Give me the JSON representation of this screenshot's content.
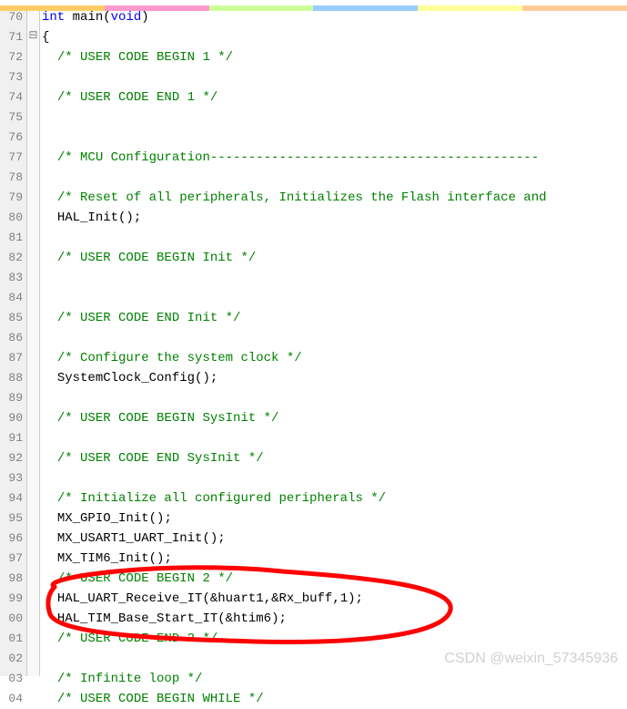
{
  "lines": [
    {
      "num": "70",
      "fold": "",
      "indent": 0,
      "tokens": [
        {
          "t": "kw",
          "v": "int"
        },
        {
          "t": "plain",
          "v": " main"
        },
        {
          "t": "paren",
          "v": "("
        },
        {
          "t": "kw",
          "v": "void"
        },
        {
          "t": "paren",
          "v": ")"
        }
      ]
    },
    {
      "num": "71",
      "fold": "⊟",
      "indent": 0,
      "tokens": [
        {
          "t": "paren",
          "v": "{"
        }
      ]
    },
    {
      "num": "72",
      "fold": "",
      "indent": 1,
      "tokens": [
        {
          "t": "comment",
          "v": "/* USER CODE BEGIN 1 */"
        }
      ]
    },
    {
      "num": "73",
      "fold": "",
      "indent": 0,
      "tokens": []
    },
    {
      "num": "74",
      "fold": "",
      "indent": 1,
      "tokens": [
        {
          "t": "comment",
          "v": "/* USER CODE END 1 */"
        }
      ]
    },
    {
      "num": "75",
      "fold": "",
      "indent": 0,
      "tokens": []
    },
    {
      "num": "76",
      "fold": "",
      "indent": 0,
      "tokens": []
    },
    {
      "num": "77",
      "fold": "",
      "indent": 1,
      "tokens": [
        {
          "t": "comment",
          "v": "/* MCU Configuration-------------------------------------------"
        }
      ]
    },
    {
      "num": "78",
      "fold": "",
      "indent": 0,
      "tokens": []
    },
    {
      "num": "79",
      "fold": "",
      "indent": 1,
      "tokens": [
        {
          "t": "comment",
          "v": "/* Reset of all peripherals, Initializes the Flash interface and"
        }
      ]
    },
    {
      "num": "80",
      "fold": "",
      "indent": 1,
      "tokens": [
        {
          "t": "plain",
          "v": "HAL_Init"
        },
        {
          "t": "paren",
          "v": "();"
        }
      ]
    },
    {
      "num": "81",
      "fold": "",
      "indent": 0,
      "tokens": []
    },
    {
      "num": "82",
      "fold": "",
      "indent": 1,
      "tokens": [
        {
          "t": "comment",
          "v": "/* USER CODE BEGIN Init */"
        }
      ]
    },
    {
      "num": "83",
      "fold": "",
      "indent": 0,
      "tokens": []
    },
    {
      "num": "84",
      "fold": "",
      "indent": 0,
      "tokens": []
    },
    {
      "num": "85",
      "fold": "",
      "indent": 1,
      "tokens": [
        {
          "t": "comment",
          "v": "/* USER CODE END Init */"
        }
      ]
    },
    {
      "num": "86",
      "fold": "",
      "indent": 0,
      "tokens": []
    },
    {
      "num": "87",
      "fold": "",
      "indent": 1,
      "tokens": [
        {
          "t": "comment",
          "v": "/* Configure the system clock */"
        }
      ]
    },
    {
      "num": "88",
      "fold": "",
      "indent": 1,
      "tokens": [
        {
          "t": "plain",
          "v": "SystemClock_Config"
        },
        {
          "t": "paren",
          "v": "();"
        }
      ]
    },
    {
      "num": "89",
      "fold": "",
      "indent": 0,
      "tokens": []
    },
    {
      "num": "90",
      "fold": "",
      "indent": 1,
      "tokens": [
        {
          "t": "comment",
          "v": "/* USER CODE BEGIN SysInit */"
        }
      ]
    },
    {
      "num": "91",
      "fold": "",
      "indent": 0,
      "tokens": []
    },
    {
      "num": "92",
      "fold": "",
      "indent": 1,
      "tokens": [
        {
          "t": "comment",
          "v": "/* USER CODE END SysInit */"
        }
      ]
    },
    {
      "num": "93",
      "fold": "",
      "indent": 0,
      "tokens": []
    },
    {
      "num": "94",
      "fold": "",
      "indent": 1,
      "tokens": [
        {
          "t": "comment",
          "v": "/* Initialize all configured peripherals */"
        }
      ]
    },
    {
      "num": "95",
      "fold": "",
      "indent": 1,
      "tokens": [
        {
          "t": "plain",
          "v": "MX_GPIO_Init"
        },
        {
          "t": "paren",
          "v": "();"
        }
      ]
    },
    {
      "num": "96",
      "fold": "",
      "indent": 1,
      "tokens": [
        {
          "t": "plain",
          "v": "MX_USART1_UART_Init"
        },
        {
          "t": "paren",
          "v": "();"
        }
      ]
    },
    {
      "num": "97",
      "fold": "",
      "indent": 1,
      "tokens": [
        {
          "t": "plain",
          "v": "MX_TIM6_Init"
        },
        {
          "t": "paren",
          "v": "();"
        }
      ]
    },
    {
      "num": "98",
      "fold": "",
      "indent": 1,
      "tokens": [
        {
          "t": "comment",
          "v": "/* USER CODE BEGIN 2 */"
        }
      ]
    },
    {
      "num": "99",
      "fold": "",
      "indent": 1,
      "tokens": [
        {
          "t": "plain",
          "v": "HAL_UART_Receive_IT"
        },
        {
          "t": "paren",
          "v": "(&"
        },
        {
          "t": "plain",
          "v": "huart1"
        },
        {
          "t": "paren",
          "v": ",&"
        },
        {
          "t": "plain",
          "v": "Rx_buff"
        },
        {
          "t": "paren",
          "v": ","
        },
        {
          "t": "num",
          "v": "1"
        },
        {
          "t": "paren",
          "v": ");"
        }
      ]
    },
    {
      "num": "00",
      "fold": "",
      "indent": 1,
      "tokens": [
        {
          "t": "plain",
          "v": "HAL_TIM_Base_Start_IT"
        },
        {
          "t": "paren",
          "v": "(&"
        },
        {
          "t": "plain",
          "v": "htim6"
        },
        {
          "t": "paren",
          "v": ");"
        }
      ]
    },
    {
      "num": "01",
      "fold": "",
      "indent": 1,
      "tokens": [
        {
          "t": "comment",
          "v": "/* USER CODE END 2 */"
        }
      ]
    },
    {
      "num": "02",
      "fold": "",
      "indent": 0,
      "tokens": []
    },
    {
      "num": "03",
      "fold": "",
      "indent": 1,
      "tokens": [
        {
          "t": "comment",
          "v": "/* Infinite loop */"
        }
      ]
    },
    {
      "num": "04",
      "fold": "",
      "indent": 1,
      "tokens": [
        {
          "t": "comment",
          "v": "/* USER CODE BEGIN WHILE */"
        }
      ]
    }
  ],
  "watermark": "CSDN @weixin_57345936",
  "top_colors": [
    "#ffcc00",
    "#ff99cc",
    "#ccff99",
    "#99ccff",
    "#ffff99"
  ]
}
